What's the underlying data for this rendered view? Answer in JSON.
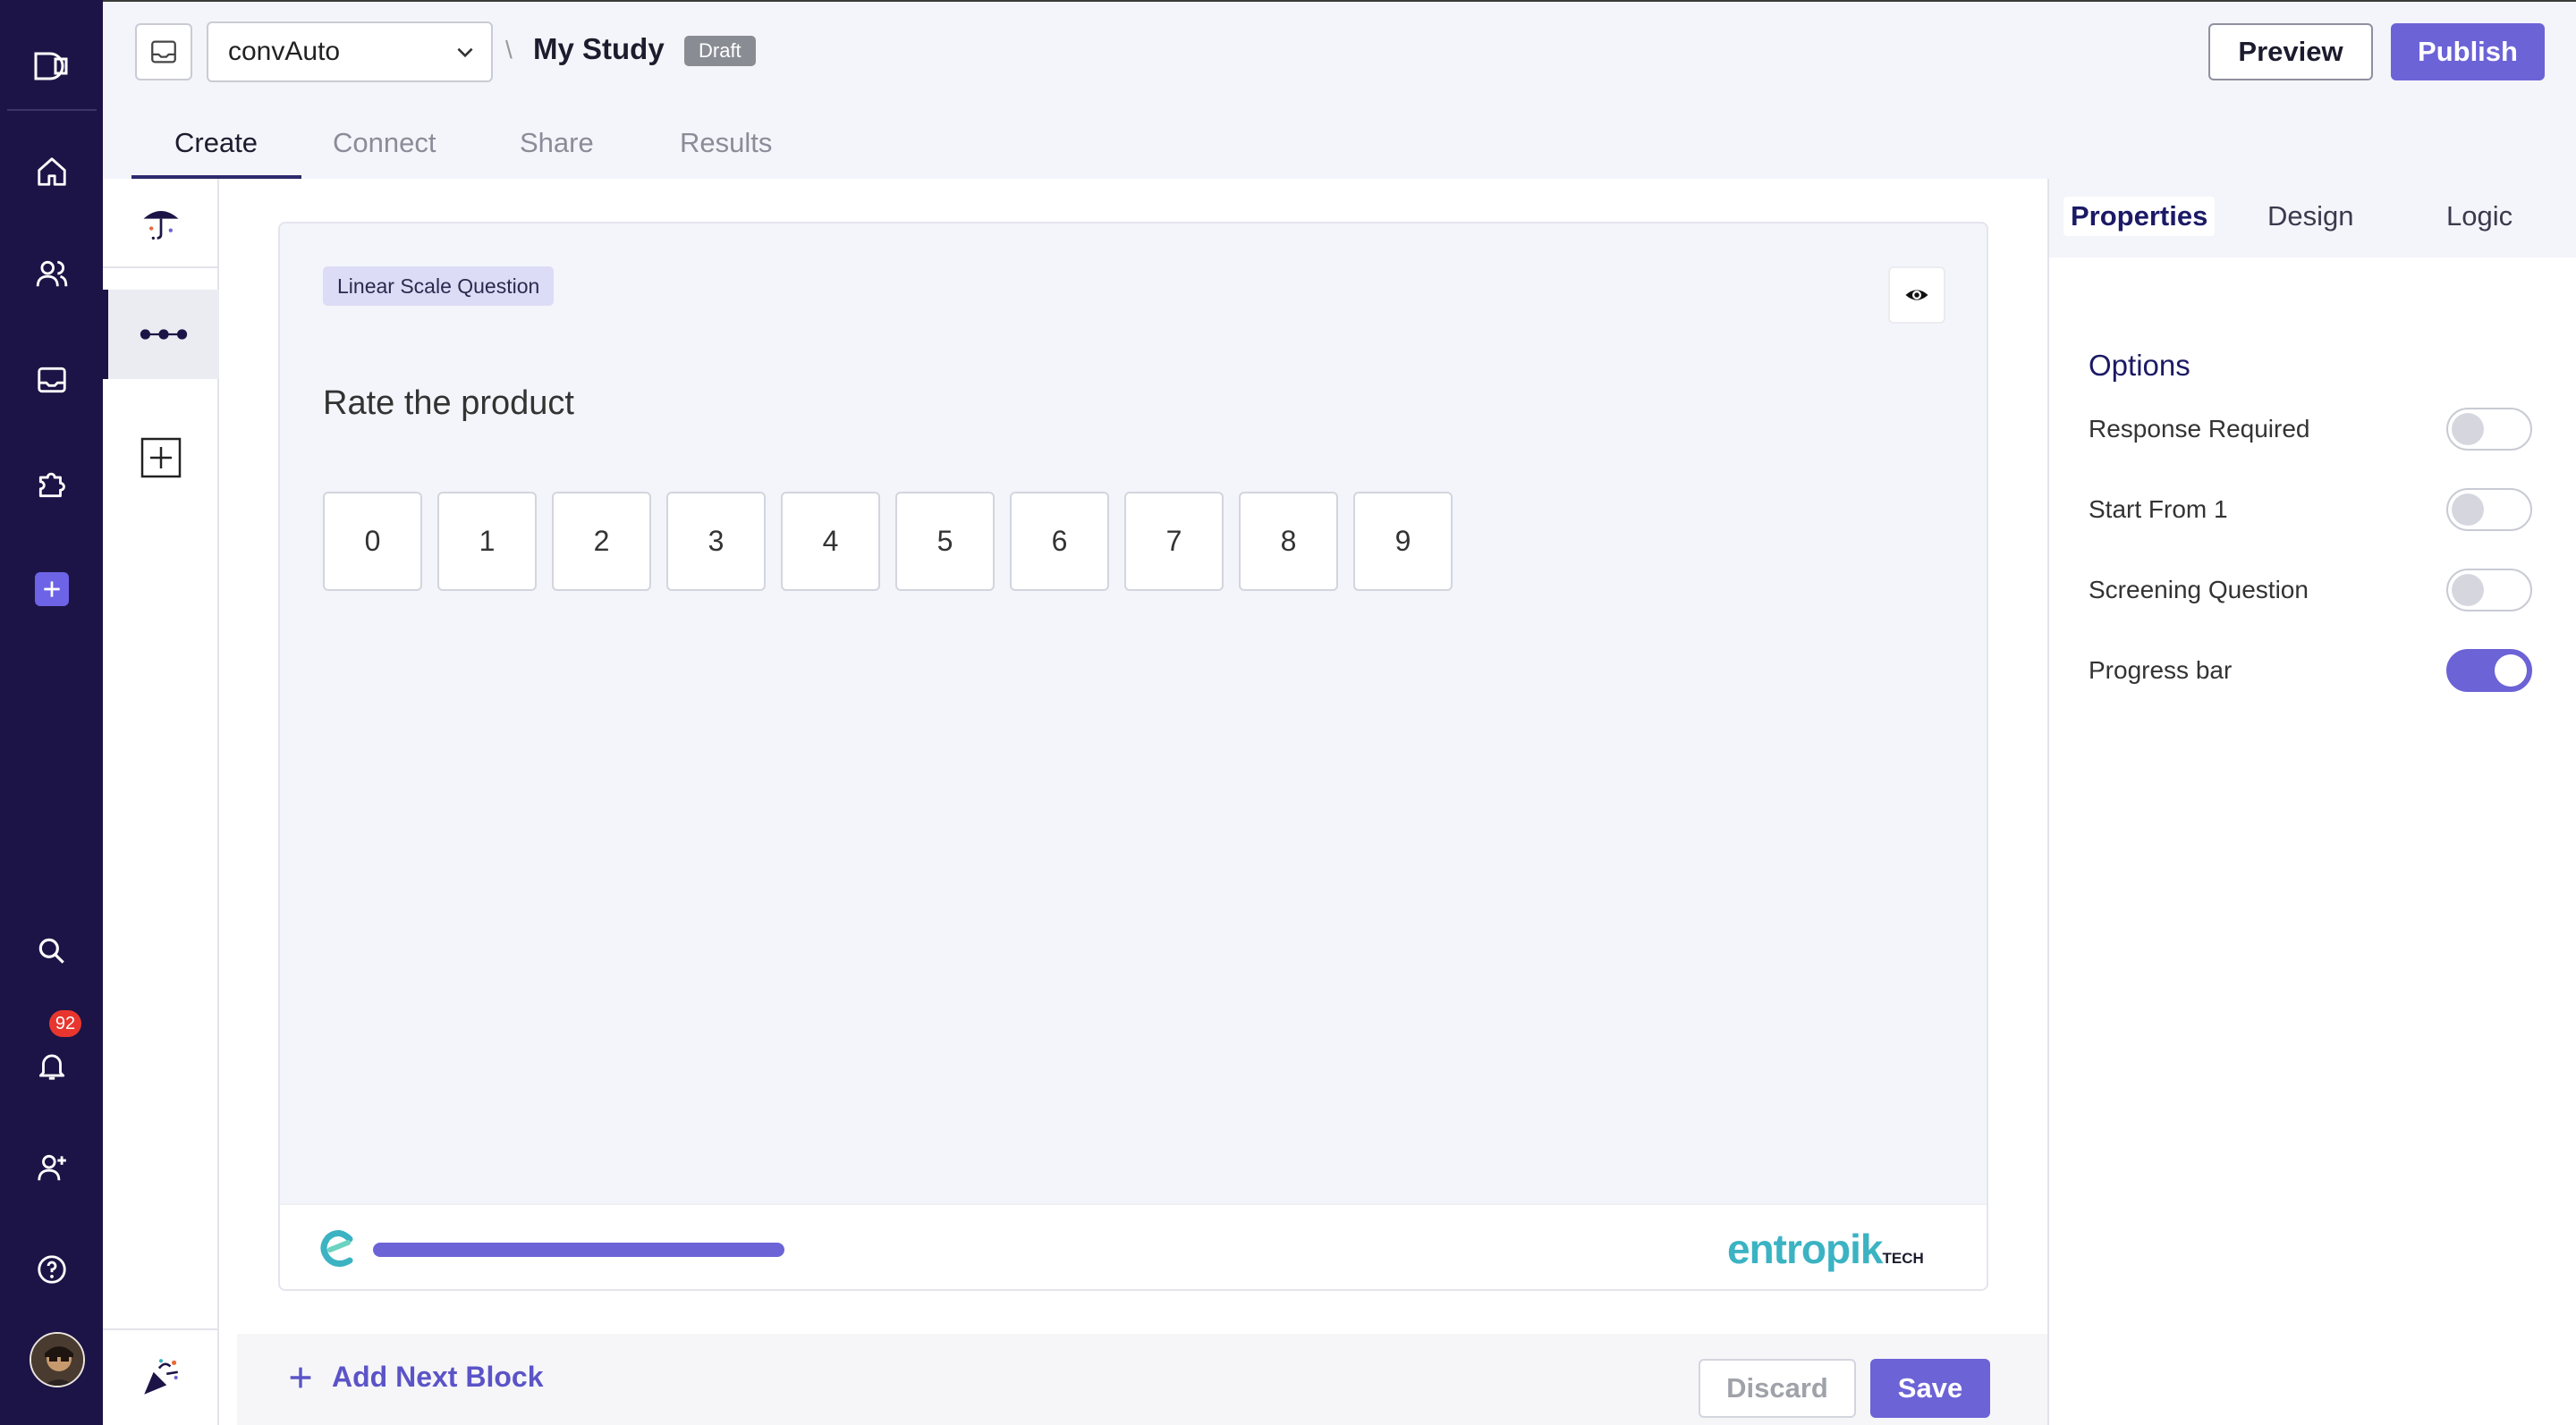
{
  "header": {
    "workspace_name": "convAuto",
    "breadcrumb_separator": "\\",
    "study_title": "My Study",
    "status_badge": "Draft",
    "preview_label": "Preview",
    "publish_label": "Publish"
  },
  "tabs": [
    {
      "label": "Create",
      "active": true
    },
    {
      "label": "Connect",
      "active": false
    },
    {
      "label": "Share",
      "active": false
    },
    {
      "label": "Results",
      "active": false
    }
  ],
  "nav": {
    "notification_count": "92"
  },
  "question": {
    "type_label": "Linear Scale Question",
    "text": "Rate the product",
    "scale": [
      "0",
      "1",
      "2",
      "3",
      "4",
      "5",
      "6",
      "7",
      "8",
      "9"
    ]
  },
  "card_footer": {
    "progress": 1.0,
    "brand": "entropik",
    "brand_suffix": "TECH"
  },
  "actions": {
    "add_next_block": "Add Next Block",
    "discard": "Discard",
    "save": "Save"
  },
  "properties": {
    "tabs": [
      {
        "label": "Properties",
        "active": true
      },
      {
        "label": "Design",
        "active": false
      },
      {
        "label": "Logic",
        "active": false
      }
    ],
    "section_title": "Options",
    "options": [
      {
        "label": "Response Required",
        "on": false
      },
      {
        "label": "Start From 1",
        "on": false
      },
      {
        "label": "Screening Question",
        "on": false
      },
      {
        "label": "Progress bar",
        "on": true
      }
    ]
  },
  "colors": {
    "nav_bg": "#1c1446",
    "accent": "#6c63d6",
    "brand_teal": "#3bb3c3",
    "badge_red": "#e8362f"
  }
}
